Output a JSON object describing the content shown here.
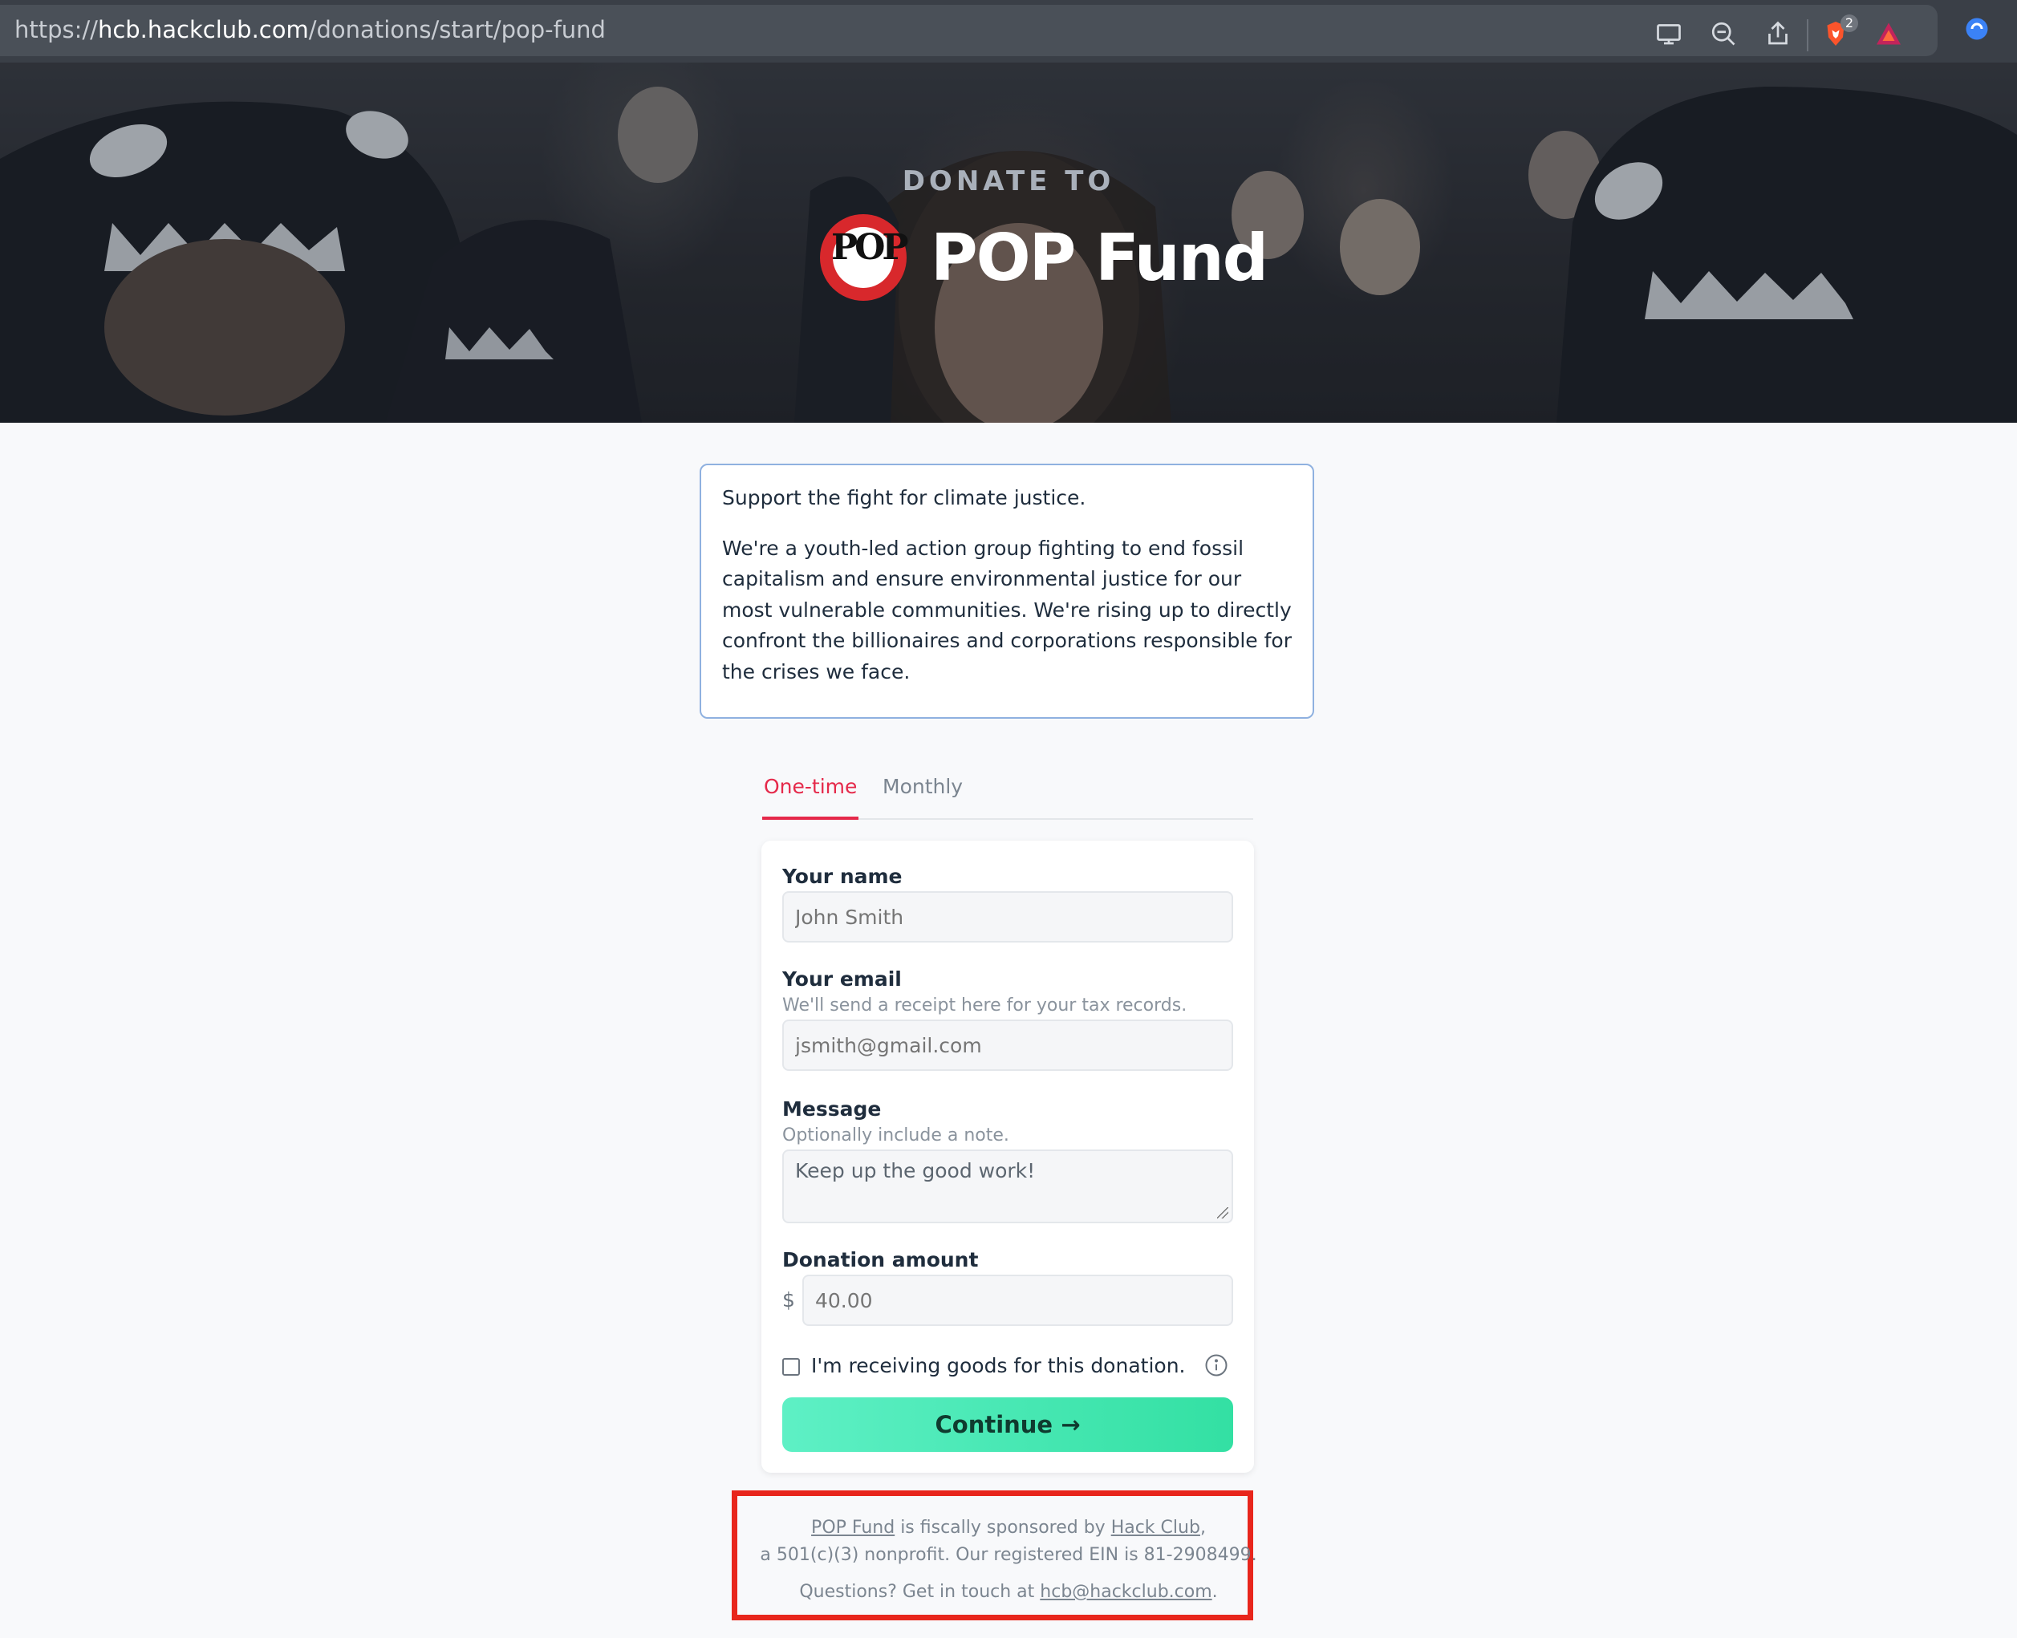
{
  "browser": {
    "url_prefix": "https://",
    "url_host": "hcb.hackclub.com",
    "url_path": "/donations/start/pop-fund",
    "shields_count": "2",
    "icons": [
      "cast-icon",
      "zoom-out-icon",
      "share-icon",
      "brave-shields-icon",
      "brave-rewards-icon",
      "extension-icon"
    ]
  },
  "hero": {
    "kicker": "DONATE TO",
    "logo_text": "POP",
    "title": "POP Fund"
  },
  "description": {
    "paragraphs": [
      "Support the fight for climate justice.",
      "We're a youth-led action group fighting to end fossil capitalism and ensure environmental justice for our most vulnerable communities. We're rising up to directly confront the billionaires and corporations responsible for the crises we face."
    ]
  },
  "tabs": {
    "one_time": "One-time",
    "monthly": "Monthly",
    "active": "One-time"
  },
  "form": {
    "name_label": "Your name",
    "name_placeholder": "John Smith",
    "email_label": "Your email",
    "email_hint": "We'll send a receipt here for your tax records.",
    "email_placeholder": "jsmith@gmail.com",
    "message_label": "Message",
    "message_hint": "Optionally include a note.",
    "message_placeholder": "Keep up the good work!",
    "amount_label": "Donation amount",
    "currency_symbol": "$",
    "amount_placeholder": "40.00",
    "goods_label": "I'm receiving goods for this donation.",
    "continue_label": "Continue →"
  },
  "footer": {
    "org_link": "POP Fund",
    "sponsored_text": " is fiscally sponsored by ",
    "sponsor_link": "Hack Club",
    "comma": ",",
    "line2": "a 501(c)(3) nonprofit. Our registered EIN is 81-2908499.",
    "questions_text": "Questions? Get in touch at ",
    "email_link": "hcb@hackclub.com",
    "period": "."
  },
  "colors": {
    "accent_red": "#e5294a",
    "continue_green": "#33e0a3",
    "highlight_red": "#e8261c"
  }
}
